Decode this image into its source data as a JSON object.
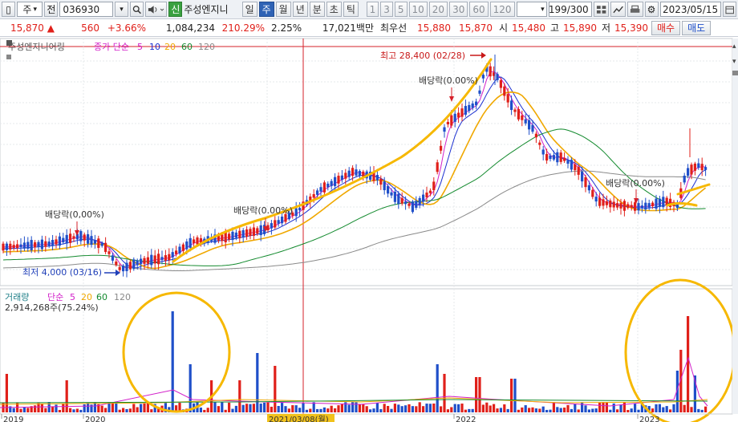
{
  "toolbar": {
    "market": "주",
    "prefix_label": "전",
    "code": "036930",
    "sin_badge": "신",
    "stock_name": "주성엔지니",
    "periods": [
      "일",
      "주",
      "월",
      "년",
      "분",
      "초",
      "틱"
    ],
    "active_period": "주",
    "intervals": [
      "1",
      "3",
      "5",
      "10",
      "20",
      "30",
      "60",
      "120"
    ],
    "range": "199/300",
    "date": "2023/05/15"
  },
  "quote": {
    "price": "15,870",
    "change_arrow": "▲",
    "change": "560",
    "change_pct": "+3.66%",
    "volume": "1,084,234",
    "volume_ratio": "210.29%",
    "turnover": "2.25%",
    "amount": "17,021백만",
    "best_bid_label": "최우선",
    "best_ask": "15,880",
    "best_bid": "15,870",
    "open_label": "시",
    "open": "15,480",
    "high_label": "고",
    "high": "15,890",
    "low_label": "저",
    "low": "15,390",
    "buy_label": "매수",
    "sell_label": "매도"
  },
  "price_panel": {
    "legend_name": "주성엔지니어링",
    "legend_ma": "종가 단순",
    "ma_periods": [
      "5",
      "10",
      "20",
      "60",
      "120"
    ],
    "ma_colors": [
      "#d21fc9",
      "#1a2fd0",
      "#f0a800",
      "#138a2e",
      "#8a8a8a"
    ],
    "annotations": {
      "high": "최고 28,400 (02/28)",
      "low": "최저 4,000 (03/16)",
      "dividend": "배당락(0.00%)",
      "dividend_1": "배당락(0,00%)",
      "dividend_4": "배당락(0,00%)"
    }
  },
  "volume_panel": {
    "legend_name": "거래량",
    "legend_ma": "단순",
    "ma_periods": [
      "5",
      "20",
      "60",
      "120"
    ],
    "value": "2,914,268주(75.24%)"
  },
  "x_axis": {
    "labels": [
      "2019",
      "2020",
      "2021/03/08(월)",
      "2022",
      "2023"
    ]
  },
  "colors": {
    "up": "#e0201a",
    "down": "#1f4fc9",
    "highlight": "#f6b800",
    "cursor": "#d6202a"
  }
}
